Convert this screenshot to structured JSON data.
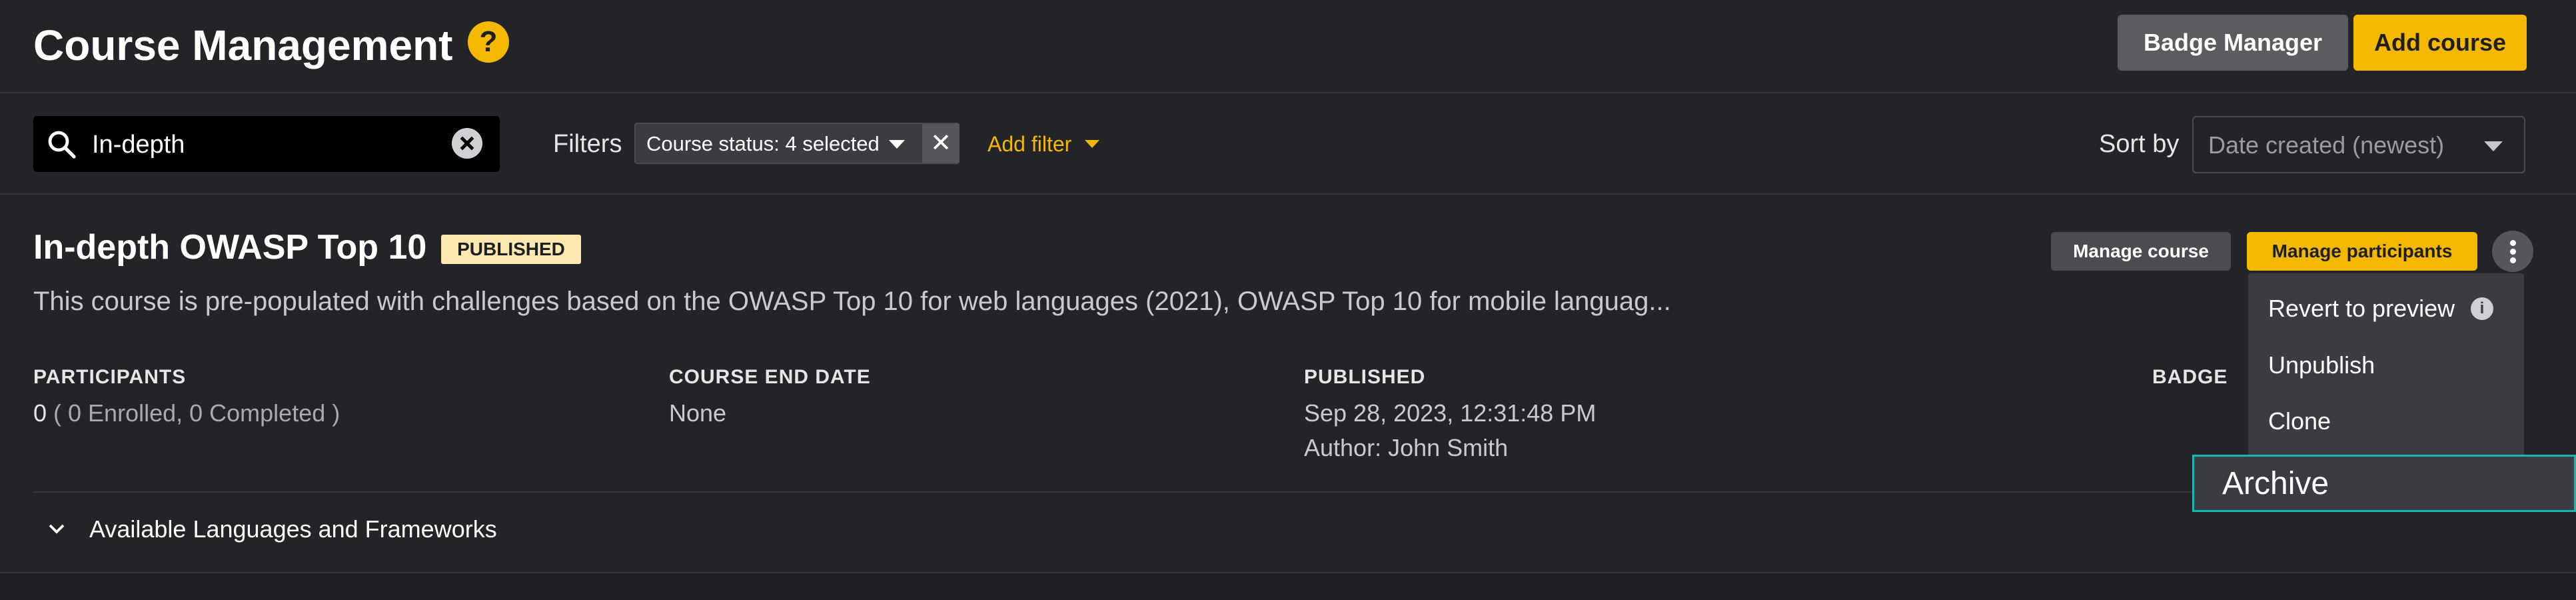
{
  "header": {
    "title": "Course Management",
    "help_icon": "?",
    "badge_manager_label": "Badge Manager",
    "add_course_label": "Add course"
  },
  "toolbar": {
    "search": {
      "value": "In-depth",
      "icon": "search-icon"
    },
    "filters_label": "Filters",
    "status_filter_chip": "Course status: 4 selected",
    "add_filter_label": "Add filter",
    "sort_label": "Sort by",
    "sort_value": "Date created (newest)"
  },
  "course": {
    "title": "In-depth OWASP Top 10",
    "status": "PUBLISHED",
    "manage_course_label": "Manage course",
    "manage_participants_label": "Manage participants",
    "description": "This course is pre-populated with challenges based on the OWASP Top 10 for web languages (2021), OWASP Top 10 for mobile languag...",
    "participants_label": "PARTICIPANTS",
    "participants_value": "0",
    "participants_detail": " ( 0 Enrolled, 0 Completed )",
    "end_date_label": "COURSE END DATE",
    "end_date_value": "None",
    "published_label": "PUBLISHED",
    "published_date": "Sep 28, 2023, 12:31:48 PM",
    "published_author": "Author: John Smith",
    "badge_label": "BADGE",
    "languages_label": "Available Languages and Frameworks"
  },
  "menu": {
    "items": [
      "Revert to preview",
      "Unpublish",
      "Clone",
      "Archive"
    ],
    "info_icon": "i"
  },
  "colors": {
    "background": "#1e1f22",
    "panel": "#232427",
    "accent": "#f5b800",
    "focus_outline": "#14b8b0"
  }
}
